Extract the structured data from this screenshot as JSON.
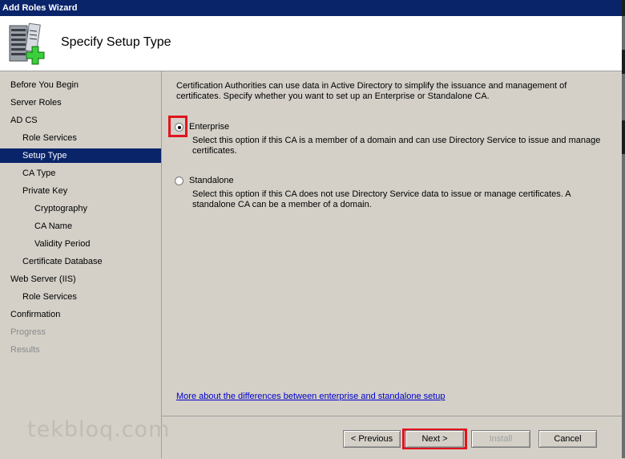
{
  "window": {
    "title": "Add Roles Wizard"
  },
  "header": {
    "title": "Specify Setup Type"
  },
  "nav": {
    "items": [
      {
        "label": "Before You Begin"
      },
      {
        "label": "Server Roles"
      },
      {
        "label": "AD CS"
      },
      {
        "label": "Role Services"
      },
      {
        "label": "Setup Type"
      },
      {
        "label": "CA Type"
      },
      {
        "label": "Private Key"
      },
      {
        "label": "Cryptography"
      },
      {
        "label": "CA Name"
      },
      {
        "label": "Validity Period"
      },
      {
        "label": "Certificate Database"
      },
      {
        "label": "Web Server (IIS)"
      },
      {
        "label": "Role Services"
      },
      {
        "label": "Confirmation"
      },
      {
        "label": "Progress"
      },
      {
        "label": "Results"
      }
    ]
  },
  "content": {
    "intro": "Certification Authorities can use data in Active Directory to simplify the issuance and management of certificates. Specify whether you want to set up an Enterprise or Standalone CA.",
    "options": [
      {
        "label": "Enterprise",
        "description": "Select this option if this CA is a member of a domain and can use Directory Service to issue and manage certificates."
      },
      {
        "label": "Standalone",
        "description": "Select this option if this CA does not use Directory Service data to issue or manage certificates. A standalone CA can be a member of a domain."
      }
    ],
    "link": "More about the differences between enterprise and standalone setup"
  },
  "buttons": {
    "previous": "< Previous",
    "next": "Next >",
    "install": "Install",
    "cancel": "Cancel"
  },
  "watermark": "tekbloq.com",
  "colors": {
    "selection": "#0a246a",
    "highlight": "#e0141e",
    "link": "#0000c8"
  }
}
